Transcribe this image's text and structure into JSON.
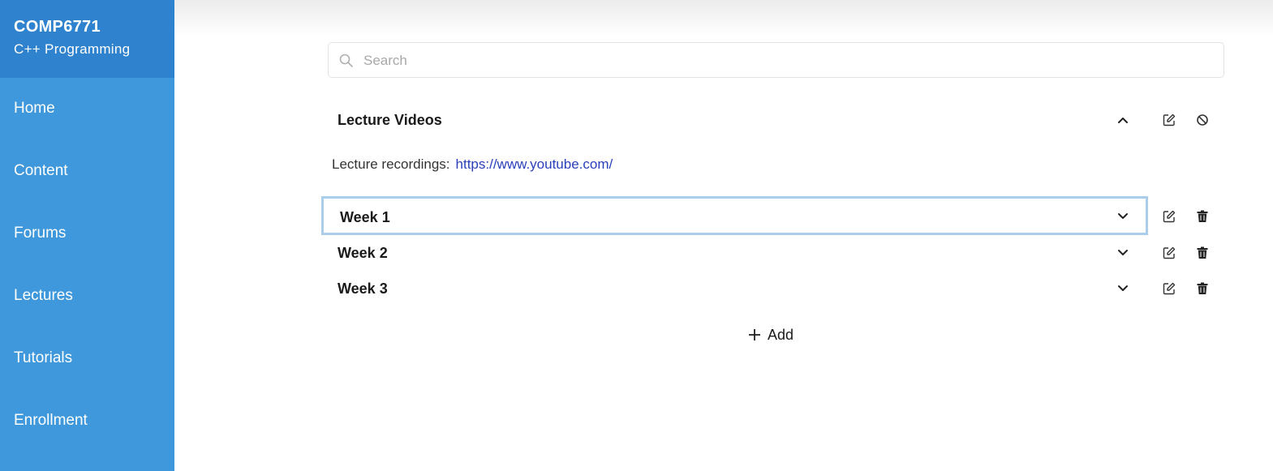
{
  "course": {
    "code": "COMP6771",
    "name": "C++ Programming"
  },
  "nav": {
    "items": [
      {
        "label": "Home"
      },
      {
        "label": "Content"
      },
      {
        "label": "Forums"
      },
      {
        "label": "Lectures"
      },
      {
        "label": "Tutorials"
      },
      {
        "label": "Enrollment"
      }
    ]
  },
  "search": {
    "placeholder": "Search",
    "value": ""
  },
  "section": {
    "title": "Lecture Videos",
    "description_label": "Lecture recordings:",
    "link": "https://www.youtube.com/",
    "expanded": true
  },
  "weeks": [
    {
      "label": "Week 1",
      "selected": true
    },
    {
      "label": "Week 2",
      "selected": false
    },
    {
      "label": "Week 3",
      "selected": false
    }
  ],
  "add": {
    "label": "Add"
  },
  "colors": {
    "sidebar": "#3f98dc",
    "sidebar_header": "#2f82cd",
    "link": "#2a3fb8",
    "selected_border": "#a9cdea"
  }
}
